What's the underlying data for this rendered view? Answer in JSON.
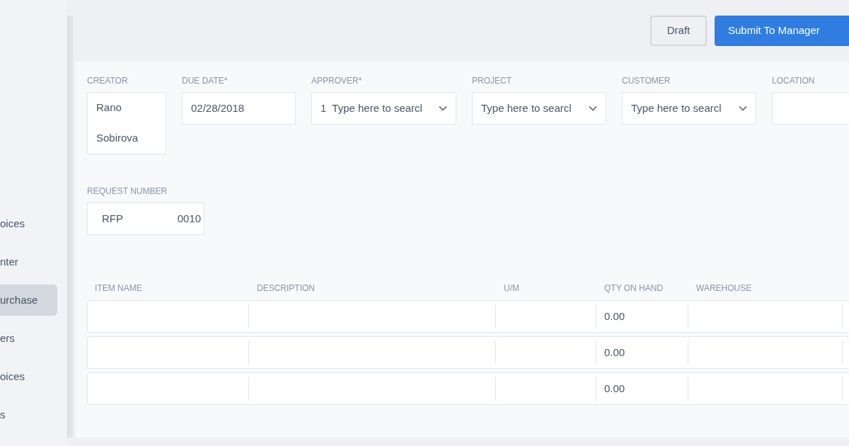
{
  "sidebar": {
    "items": [
      {
        "label": "oices",
        "selected": false
      },
      {
        "label": "nter",
        "selected": false
      },
      {
        "label": "urchase",
        "selected": true
      },
      {
        "label": "ers",
        "selected": false
      },
      {
        "label": "oices",
        "selected": false
      },
      {
        "label": "s",
        "selected": false
      }
    ]
  },
  "actions": [
    {
      "label": "Draft",
      "kind": "outline"
    },
    {
      "label": "Submit To Manager",
      "kind": "primary"
    }
  ],
  "fields": [
    {
      "label": "CREATOR",
      "kind": "static",
      "lines": [
        "Rano",
        "Sobirova"
      ]
    },
    {
      "label": "DUE DATE*",
      "kind": "text",
      "value": "02/28/2018"
    },
    {
      "label": "APPROVER*",
      "kind": "select",
      "value": "1",
      "placeholder": "Type here to searcl"
    },
    {
      "label": "PROJECT",
      "kind": "select",
      "placeholder": "Type here to searcl"
    },
    {
      "label": "CUSTOMER",
      "kind": "select",
      "placeholder": "Type here to searcl"
    },
    {
      "label": "LOCATION",
      "kind": "text"
    }
  ],
  "request_number": {
    "label": "REQUEST NUMBER",
    "prefix": "RFP",
    "number": "0010"
  },
  "table": {
    "columns": [
      "ITEM NAME",
      "DESCRIPTION",
      "U/M",
      "QTY ON HAND",
      "WAREHOUSE"
    ],
    "rows": [
      {
        "qty_on_hand": "0.00"
      },
      {
        "qty_on_hand": "0.00"
      },
      {
        "qty_on_hand": "0.00"
      }
    ]
  }
}
